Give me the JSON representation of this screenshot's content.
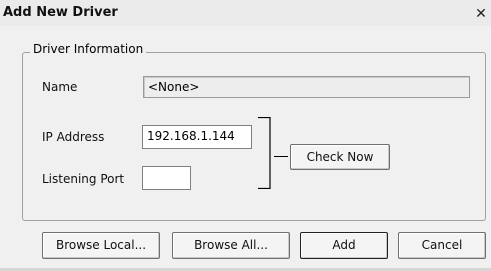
{
  "window": {
    "title": "Add New Driver",
    "close_glyph": "✕"
  },
  "group": {
    "legend": "Driver Information"
  },
  "form": {
    "name_label": "Name",
    "name_value": "<None>",
    "ip_label": "IP Address",
    "ip_value": "192.168.1.144",
    "port_label": "Listening Port",
    "port_value": ""
  },
  "buttons": {
    "check_now": "Check Now",
    "browse_local": "Browse Local...",
    "browse_all": "Browse All...",
    "add": "Add",
    "cancel": "Cancel"
  },
  "icons": {
    "close": "close-icon"
  },
  "colors": {
    "dialog_bg": "#f0f0f0",
    "title_bg": "#ebebeb"
  }
}
